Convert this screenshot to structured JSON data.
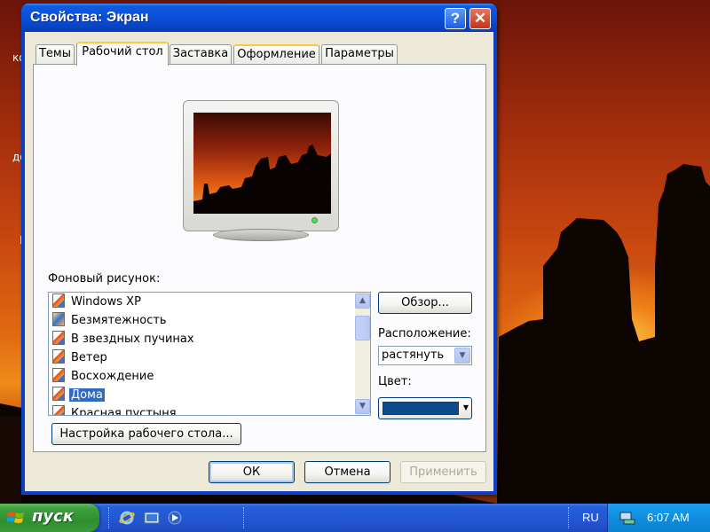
{
  "desktop": {
    "icon_labels": [
      "ко",
      "до",
      "Н"
    ]
  },
  "window": {
    "title": "Свойства: Экран",
    "help_glyph": "?",
    "close_glyph": "✕",
    "tabs": [
      {
        "label": "Темы",
        "state": "normal"
      },
      {
        "label": "Рабочий стол",
        "state": "active"
      },
      {
        "label": "Заставка",
        "state": "normal"
      },
      {
        "label": "Оформление",
        "state": "hover"
      },
      {
        "label": "Параметры",
        "state": "normal"
      }
    ],
    "background_label": "Фоновый рисунок:",
    "backgrounds": [
      {
        "label": "Windows XP",
        "icon": "image-file-icon"
      },
      {
        "label": "Безмятежность",
        "icon": "image-file-icon"
      },
      {
        "label": "В звездных пучинах",
        "icon": "image-file-icon"
      },
      {
        "label": "Ветер",
        "icon": "image-file-icon"
      },
      {
        "label": "Восхождение",
        "icon": "image-file-icon"
      },
      {
        "label": "Дома",
        "icon": "image-file-icon",
        "selected": true
      },
      {
        "label": "Красная пустыня",
        "icon": "image-file-icon"
      }
    ],
    "browse_label": "Обзор...",
    "position_label": "Расположение:",
    "position_value": "растянуть",
    "color_label": "Цвет:",
    "color_value": "#0b4a8c",
    "customize_label": "Настройка рабочего стола...",
    "ok_label": "ОК",
    "cancel_label": "Отмена",
    "apply_label": "Применить"
  },
  "taskbar": {
    "start_label": "пуск",
    "language": "RU",
    "clock": "6:07 AM"
  },
  "colors": {
    "title_bar": "#0a4fd8",
    "selection": "#316ac5",
    "taskbar": "#245edb",
    "start_button": "#3c9f3c"
  }
}
